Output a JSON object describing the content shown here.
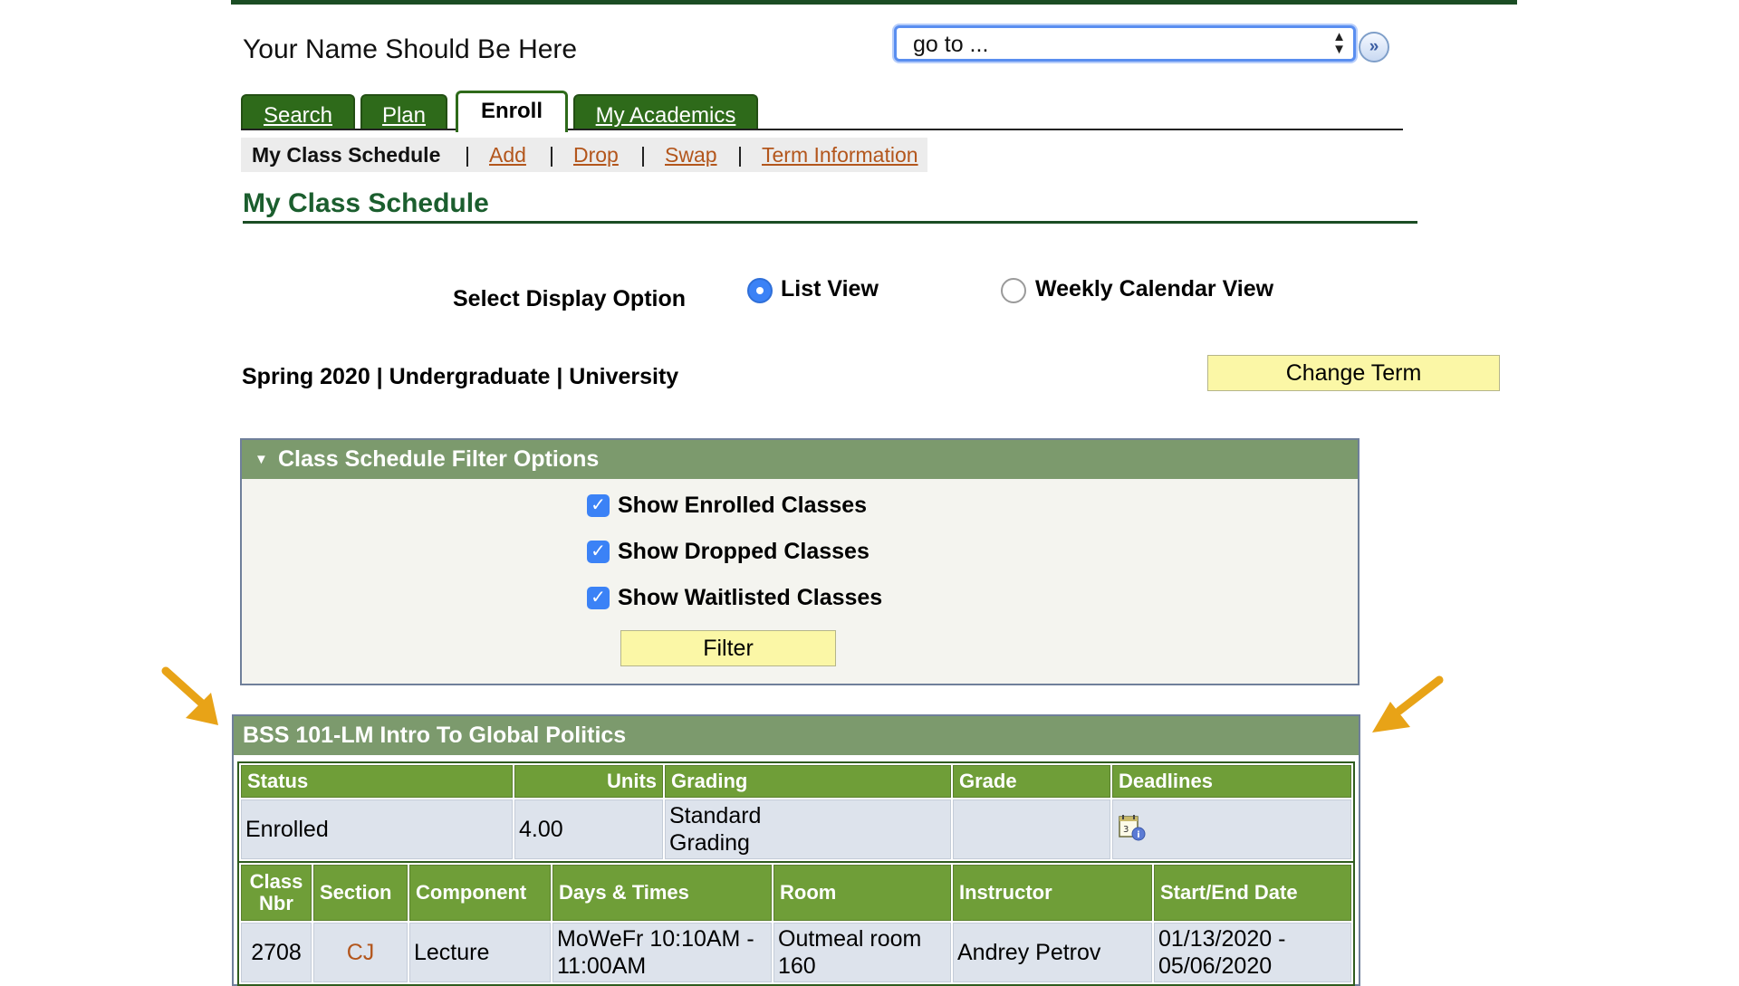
{
  "header": {
    "user_name": "Your Name Should Be Here",
    "goto_value": "go to ..."
  },
  "tabs": [
    {
      "label": "Search",
      "active": false
    },
    {
      "label": "Plan",
      "active": false
    },
    {
      "label": "Enroll",
      "active": true
    },
    {
      "label": "My Academics",
      "active": false
    }
  ],
  "subnav": {
    "current": "My Class Schedule",
    "separator": "|",
    "links": [
      "Add",
      "Drop",
      "Swap",
      "Term Information"
    ]
  },
  "page_title": "My Class Schedule",
  "display_option": {
    "label": "Select Display Option",
    "options": [
      {
        "label": "List View",
        "selected": true
      },
      {
        "label": "Weekly Calendar View",
        "selected": false
      }
    ]
  },
  "term": {
    "text": "Spring 2020 | Undergraduate | University",
    "change_button": "Change Term"
  },
  "filter": {
    "title": "Class Schedule Filter Options",
    "checkboxes": [
      {
        "label": "Show Enrolled Classes",
        "checked": true
      },
      {
        "label": "Show Dropped Classes",
        "checked": true
      },
      {
        "label": "Show Waitlisted Classes",
        "checked": true
      }
    ],
    "button": "Filter"
  },
  "course": {
    "title": "BSS 101-LM Intro To Global Politics",
    "summary_headers": [
      "Status",
      "Units",
      "Grading",
      "Grade",
      "Deadlines"
    ],
    "summary_row": {
      "status": "Enrolled",
      "units": "4.00",
      "grading_line1": "Standard",
      "grading_line2": "Grading",
      "grade": ""
    },
    "detail_headers": {
      "class_nbr_1": "Class",
      "class_nbr_2": "Nbr",
      "section": "Section",
      "component": "Component",
      "days_times": "Days & Times",
      "room": "Room",
      "instructor": "Instructor",
      "dates": "Start/End Date"
    },
    "detail_row": {
      "class_nbr": "2708",
      "section": "CJ",
      "component": "Lecture",
      "days_times_1": "MoWeFr 10:10AM -",
      "days_times_2": "11:00AM",
      "room_1": "Outmeal room",
      "room_2": "160",
      "instructor": "Andrey Petrov",
      "dates_1": "01/13/2020 -",
      "dates_2": "05/06/2020"
    }
  },
  "colors": {
    "dark_green": "#1b4d24",
    "tab_green": "#2e6a1a",
    "header_green": "#7c9a6d",
    "table_header_green": "#6f9e38",
    "link_orange": "#b3561c",
    "button_yellow": "#fbf7a6",
    "annotation_arrow": "#e8a317"
  },
  "icons": {
    "go": "double-chevron-right-icon",
    "collapse": "triangle-down-icon",
    "deadline": "calendar-info-icon",
    "annotation": "arrow-icon"
  }
}
